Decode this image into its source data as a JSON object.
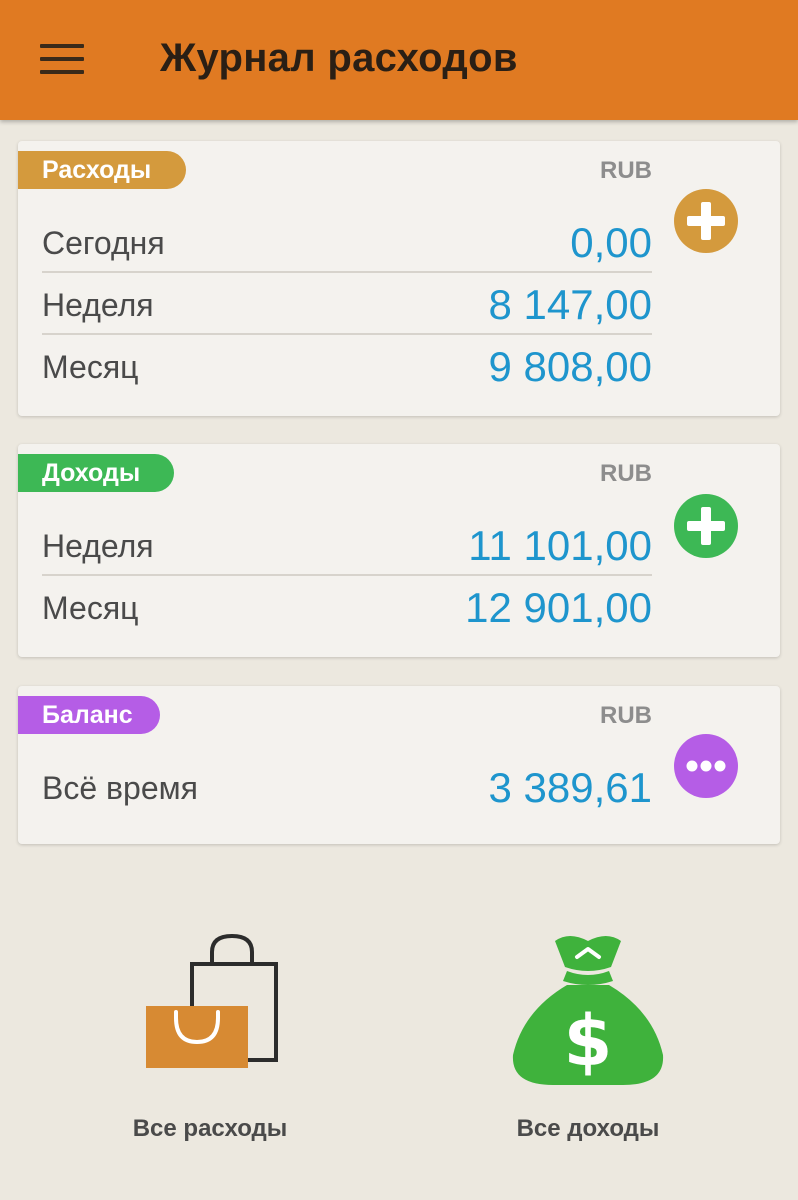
{
  "app_bar": {
    "title": "Журнал расходов",
    "color": "#e07a22"
  },
  "expenses_card": {
    "badge": "Расходы",
    "badge_color": "#d49a3d",
    "currency": "RUB",
    "rows": [
      {
        "label": "Сегодня",
        "value": "0,00"
      },
      {
        "label": "Неделя",
        "value": "8 147,00"
      },
      {
        "label": "Месяц",
        "value": "9 808,00"
      }
    ],
    "action_icon": "plus-icon"
  },
  "income_card": {
    "badge": "Доходы",
    "badge_color": "#3db855",
    "currency": "RUB",
    "rows": [
      {
        "label": "Неделя",
        "value": "11 101,00"
      },
      {
        "label": "Месяц",
        "value": "12 901,00"
      }
    ],
    "action_icon": "plus-icon"
  },
  "balance_card": {
    "badge": "Баланс",
    "badge_color": "#b55de6",
    "currency": "RUB",
    "rows": [
      {
        "label": "Всё время",
        "value": "3 389,61"
      }
    ],
    "action_icon": "more-dots-icon"
  },
  "bottom_actions": [
    {
      "label": "Все расходы",
      "icon": "shopping-bags-icon"
    },
    {
      "label": "Все доходы",
      "icon": "money-bag-icon"
    }
  ],
  "colors": {
    "value_text": "#1e95cd",
    "background": "#ece8df"
  }
}
